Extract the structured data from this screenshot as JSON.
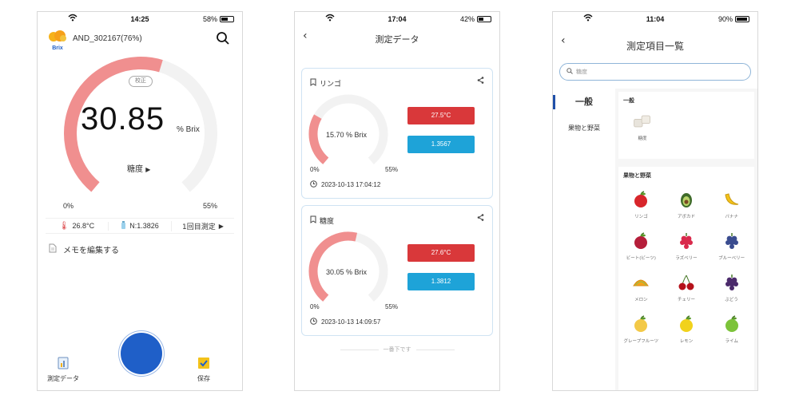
{
  "screen1": {
    "status": {
      "time": "14:25",
      "battery": "58%",
      "battery_level": 0.58
    },
    "device_name": "AND_302167(76%)",
    "logo_text": "Brix",
    "calib_label": "校正",
    "value": "30.85",
    "unit": "% Brix",
    "gauge_fraction": 0.56,
    "mode_label": "糖度",
    "min_label": "0%",
    "max_label": "55%",
    "temperature": "26.8°C",
    "nd": "N:1.3826",
    "single_measure": "1回目測定",
    "memo": "メモを編集する",
    "tab_data": "測定データ",
    "tab_save": "保存"
  },
  "screen2": {
    "status": {
      "time": "17:04",
      "battery": "42%",
      "battery_level": 0.42
    },
    "title": "測定データ",
    "records": [
      {
        "name": "リンゴ",
        "value": "15.70 % Brix",
        "fraction": 0.285,
        "min": "0%",
        "max": "55%",
        "temp": "27.5°C",
        "nd": "1.3567",
        "time": "2023-10-13 17:04:12"
      },
      {
        "name": "糖度",
        "value": "30.05 % Brix",
        "fraction": 0.546,
        "min": "0%",
        "max": "55%",
        "temp": "27.6°C",
        "nd": "1.3812",
        "time": "2023-10-13 14:09:57"
      }
    ],
    "bottom_note": "一番下です"
  },
  "screen3": {
    "status": {
      "time": "11:04",
      "battery": "90%",
      "battery_level": 0.9
    },
    "title": "測定項目一覧",
    "search_placeholder": "糖度",
    "side_active": "一般",
    "side_other": "果物と野菜",
    "section1_title": "一般",
    "general_items": [
      {
        "label": "糖度",
        "icon": "sugar-cubes-icon"
      }
    ],
    "section2_title": "果物と野菜",
    "fruits": [
      {
        "label": "リンゴ",
        "icon": "apple-icon",
        "color": "#d8262b"
      },
      {
        "label": "アボカド",
        "icon": "avocado-icon",
        "color": "#3f6b2a"
      },
      {
        "label": "バナナ",
        "icon": "banana-icon",
        "color": "#f3c21a"
      },
      {
        "label": "ビート(ビーツ)",
        "icon": "beet-icon",
        "color": "#b51e3a"
      },
      {
        "label": "ラズベリー",
        "icon": "raspberry-icon",
        "color": "#d92a4c"
      },
      {
        "label": "ブルーベリー",
        "icon": "blueberry-icon",
        "color": "#3a4c8f"
      },
      {
        "label": "メロン",
        "icon": "melon-icon",
        "color": "#f2a21c"
      },
      {
        "label": "チェリー",
        "icon": "cherry-icon",
        "color": "#b5121b"
      },
      {
        "label": "ぶどう",
        "icon": "grape-icon",
        "color": "#4b2a6b"
      },
      {
        "label": "グレープフルーツ",
        "icon": "grapefruit-icon",
        "color": "#f3c947"
      },
      {
        "label": "レモン",
        "icon": "lemon-icon",
        "color": "#f1d21c"
      },
      {
        "label": "ライム",
        "icon": "lime-icon",
        "color": "#7cc33a"
      }
    ]
  },
  "colors": {
    "gauge": "#f08f8f",
    "gauge_track": "#f2f2f2",
    "temp": "#d9383a",
    "nd": "#1ea3d8",
    "measure": "#1f5fc8"
  }
}
